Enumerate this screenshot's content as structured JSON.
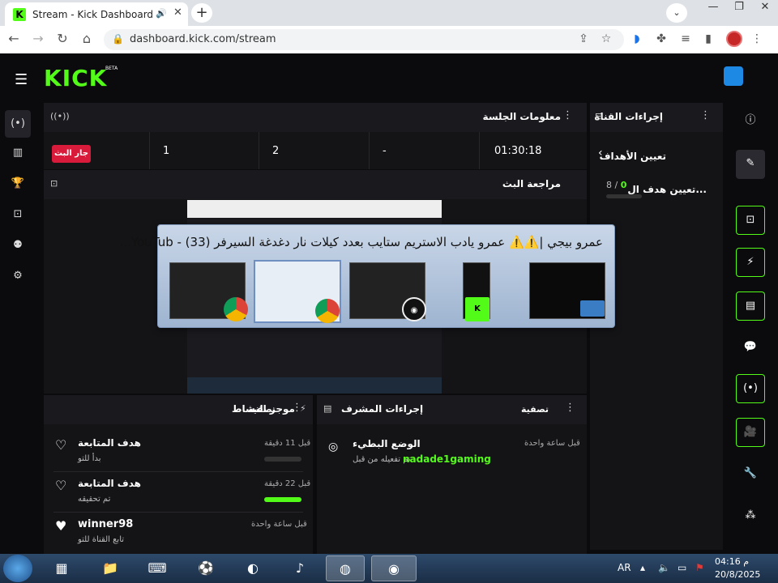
{
  "browser": {
    "tab_title": "Stream - Kick Dashboard",
    "favicon_letter": "K",
    "new_tab": "+",
    "url": "dashboard.kick.com/stream"
  },
  "kick": {
    "logo": "KICK",
    "beta": "BETA"
  },
  "session_panel": {
    "title": "معلومات الجلسة",
    "live_badge": "جار البث",
    "stats": [
      "1",
      "2",
      "-",
      "01:30:18"
    ]
  },
  "preview_panel": {
    "title": "مراجعة البث"
  },
  "channel_panel": {
    "title": "إجراءات القناة",
    "back_label": "تعيين الأهداف",
    "goal_label": "تعيين هدف ال...",
    "goal_current": "0",
    "goal_total": "8 /"
  },
  "switcher": {
    "title": "عمرو بيجي |⚠️⚠️ عمرو يادب الاستريم ستايب بعدد كيلات نار دغدغة السيرفر (33) - YouTub..."
  },
  "activity_panel": {
    "title": "موجز النشاط",
    "filter": "تصفية",
    "items": [
      {
        "title": "هدف المتابعة",
        "sub": "بدأ للتو",
        "time": "قبل 11 دقيقة",
        "progress": 0
      },
      {
        "title": "هدف المتابعة",
        "sub": "تم تحقيقه",
        "time": "قبل 22 دقيقة",
        "progress": 1
      },
      {
        "title": "winner98",
        "sub": "تابع القناة للتو",
        "time": "قبل ساعة واحدة"
      }
    ]
  },
  "mod_panel": {
    "title": "إجراءات المشرف",
    "filter": "تصفية",
    "item_title": "الوضع البطيء",
    "item_sub": "تم تفعيله من قبل",
    "item_user": "nadade1gaming",
    "item_time": "قبل ساعة واحدة"
  },
  "taskbar": {
    "lang": "AR",
    "time": "04:16 م",
    "date": "20/8/2025"
  },
  "colors": {
    "kick_green": "#53fc18",
    "live_red": "#d81b3a",
    "panel": "#141417"
  }
}
